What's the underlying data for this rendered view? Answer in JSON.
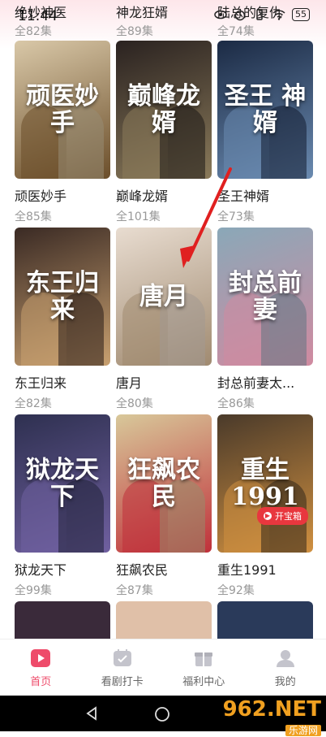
{
  "status_bar": {
    "time": "11:44",
    "battery": "55"
  },
  "top_row": [
    {
      "title": "绝妙神医",
      "eps": "全82集"
    },
    {
      "title": "神龙狂婿",
      "eps": "全89集"
    },
    {
      "title": "陆总的复仇",
      "eps": "全74集"
    }
  ],
  "grid": [
    {
      "title": "顽医妙手",
      "eps": "全85集",
      "caption": "顽医妙手",
      "bg": "#d9c8a8",
      "accent": "#6b4e2a"
    },
    {
      "title": "巅峰龙婿",
      "eps": "全101集",
      "caption": "巅峰龙婿",
      "bg": "#2a2220",
      "accent": "#8a7a5a"
    },
    {
      "title": "圣王神婿",
      "eps": "全73集",
      "caption": "圣王 神婿",
      "bg": "#1b2a44",
      "accent": "#6a8ab0"
    },
    {
      "title": "东王归来",
      "eps": "全82集",
      "caption": "东王归来",
      "bg": "#3a2a24",
      "accent": "#c8a070"
    },
    {
      "title": "唐月",
      "eps": "全80集",
      "caption": "唐月",
      "bg": "#e8dcd0",
      "accent": "#a08a70"
    },
    {
      "title": "封总前妻太...",
      "eps": "全86集",
      "caption": "封总前妻",
      "bg": "#8aa8b8",
      "accent": "#d08aa0"
    },
    {
      "title": "狱龙天下",
      "eps": "全99集",
      "caption": "狱龙天下",
      "bg": "#2e3050",
      "accent": "#7060a0"
    },
    {
      "title": "狂飙农民",
      "eps": "全87集",
      "caption": "狂飙农民",
      "bg": "#d8c89a",
      "accent": "#c0303a"
    },
    {
      "title": "重生1991",
      "eps": "全92集",
      "caption": "重生1991",
      "bg": "#4a3a2a",
      "accent": "#d09040",
      "badge": "开宝箱"
    }
  ],
  "bottom_row_colors": [
    "#3a2a3a",
    "#e0c0a8",
    "#2a3a5a"
  ],
  "bottom_nav": [
    {
      "label": "首页",
      "icon": "play-icon",
      "active": true
    },
    {
      "label": "看剧打卡",
      "icon": "calendar-check-icon",
      "active": false
    },
    {
      "label": "福利中心",
      "icon": "gift-icon",
      "active": false
    },
    {
      "label": "我的",
      "icon": "user-icon",
      "active": false
    }
  ],
  "watermark": {
    "main": "962.NET",
    "sub": "乐游网"
  },
  "colors": {
    "accent": "#ee4b6a",
    "arrow": "#e02020"
  }
}
